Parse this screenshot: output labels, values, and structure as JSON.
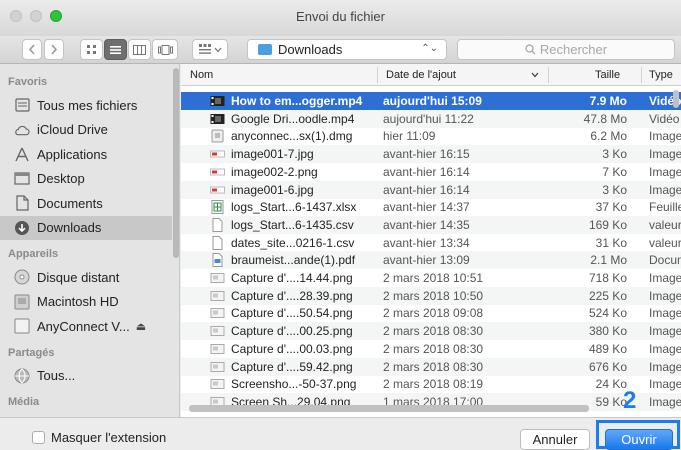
{
  "window": {
    "title": "Envoi du fichier"
  },
  "toolbar": {
    "location": "Downloads",
    "search_placeholder": "Rechercher"
  },
  "sidebar": {
    "sections": [
      {
        "heading": "Favoris",
        "items": [
          {
            "label": "Tous mes fichiers",
            "icon": "all-files-icon"
          },
          {
            "label": "iCloud Drive",
            "icon": "cloud-icon"
          },
          {
            "label": "Applications",
            "icon": "applications-icon"
          },
          {
            "label": "Desktop",
            "icon": "desktop-icon"
          },
          {
            "label": "Documents",
            "icon": "documents-icon"
          },
          {
            "label": "Downloads",
            "icon": "downloads-icon",
            "selected": true
          }
        ]
      },
      {
        "heading": "Appareils",
        "items": [
          {
            "label": "Disque distant",
            "icon": "disc-icon"
          },
          {
            "label": "Macintosh HD",
            "icon": "hard-drive-icon"
          },
          {
            "label": "AnyConnect V...",
            "icon": "volume-icon",
            "eject": "⏏"
          }
        ]
      },
      {
        "heading": "Partagés",
        "items": [
          {
            "label": "Tous...",
            "icon": "network-icon"
          }
        ]
      },
      {
        "heading": "Média",
        "items": []
      }
    ]
  },
  "columns": {
    "name": "Nom",
    "date": "Date de l'ajout",
    "size": "Taille",
    "type": "Type"
  },
  "files": [
    {
      "name": "How to em...ogger.mp4",
      "date": "aujourd'hui 15:09",
      "size": "7.9 Mo",
      "type": "Vidéo",
      "icon": "video-icon",
      "selected": true
    },
    {
      "name": "Google Dri...oodle.mp4",
      "date": "aujourd'hui 11:22",
      "size": "47.8 Mo",
      "type": "Vidéo",
      "icon": "video-icon"
    },
    {
      "name": "anyconnec...sx(1).dmg",
      "date": "hier 11:09",
      "size": "6.2 Mo",
      "type": "Image",
      "icon": "disk-image-icon"
    },
    {
      "name": "image001-7.jpg",
      "date": "avant-hier 16:15",
      "size": "3 Ko",
      "type": "Image",
      "icon": "image-icon"
    },
    {
      "name": "image002-2.png",
      "date": "avant-hier 16:14",
      "size": "7 Ko",
      "type": "Image",
      "icon": "image-icon"
    },
    {
      "name": "image001-6.jpg",
      "date": "avant-hier 16:14",
      "size": "3 Ko",
      "type": "Image",
      "icon": "image-icon"
    },
    {
      "name": "logs_Start...6-1437.xlsx",
      "date": "avant-hier 14:37",
      "size": "37 Ko",
      "type": "Feuille",
      "icon": "spreadsheet-icon"
    },
    {
      "name": "logs_Start...6-1435.csv",
      "date": "avant-hier 14:35",
      "size": "169 Ko",
      "type": "valeurs",
      "icon": "document-icon"
    },
    {
      "name": "dates_site...0216-1.csv",
      "date": "avant-hier 13:34",
      "size": "31 Ko",
      "type": "valeurs",
      "icon": "document-icon"
    },
    {
      "name": "braumeist...ande(1).pdf",
      "date": "avant-hier 13:09",
      "size": "2.1 Mo",
      "type": "Document",
      "icon": "pdf-icon"
    },
    {
      "name": "Capture d'....14.44.png",
      "date": "2 mars 2018 10:51",
      "size": "718 Ko",
      "type": "Image",
      "icon": "screenshot-icon"
    },
    {
      "name": "Capture d'....28.39.png",
      "date": "2 mars 2018 10:50",
      "size": "225 Ko",
      "type": "Image",
      "icon": "screenshot-icon"
    },
    {
      "name": "Capture d'....50.54.png",
      "date": "2 mars 2018 09:08",
      "size": "524 Ko",
      "type": "Image",
      "icon": "screenshot-icon"
    },
    {
      "name": "Capture d'....00.25.png",
      "date": "2 mars 2018 08:30",
      "size": "380 Ko",
      "type": "Image",
      "icon": "screenshot-icon"
    },
    {
      "name": "Capture d'....00.03.png",
      "date": "2 mars 2018 08:30",
      "size": "489 Ko",
      "type": "Image",
      "icon": "screenshot-icon"
    },
    {
      "name": "Capture d'....59.42.png",
      "date": "2 mars 2018 08:30",
      "size": "676 Ko",
      "type": "Image",
      "icon": "screenshot-icon"
    },
    {
      "name": "Screensho...-50-37.png",
      "date": "2 mars 2018 08:19",
      "size": "24 Ko",
      "type": "Image",
      "icon": "screenshot-icon"
    },
    {
      "name": "Screen Sh...29.04.png",
      "date": "1 mars 2018 17:00",
      "size": "59 Ko",
      "type": "Image",
      "icon": "screenshot-icon"
    }
  ],
  "footer": {
    "hide_extension_label": "Masquer l'extension",
    "cancel_label": "Annuler",
    "open_label": "Ouvrir",
    "step_number": "2"
  },
  "colors": {
    "selection": "#2e6fd6",
    "accent": "#1a7df2",
    "folder": "#4b9ee0"
  }
}
